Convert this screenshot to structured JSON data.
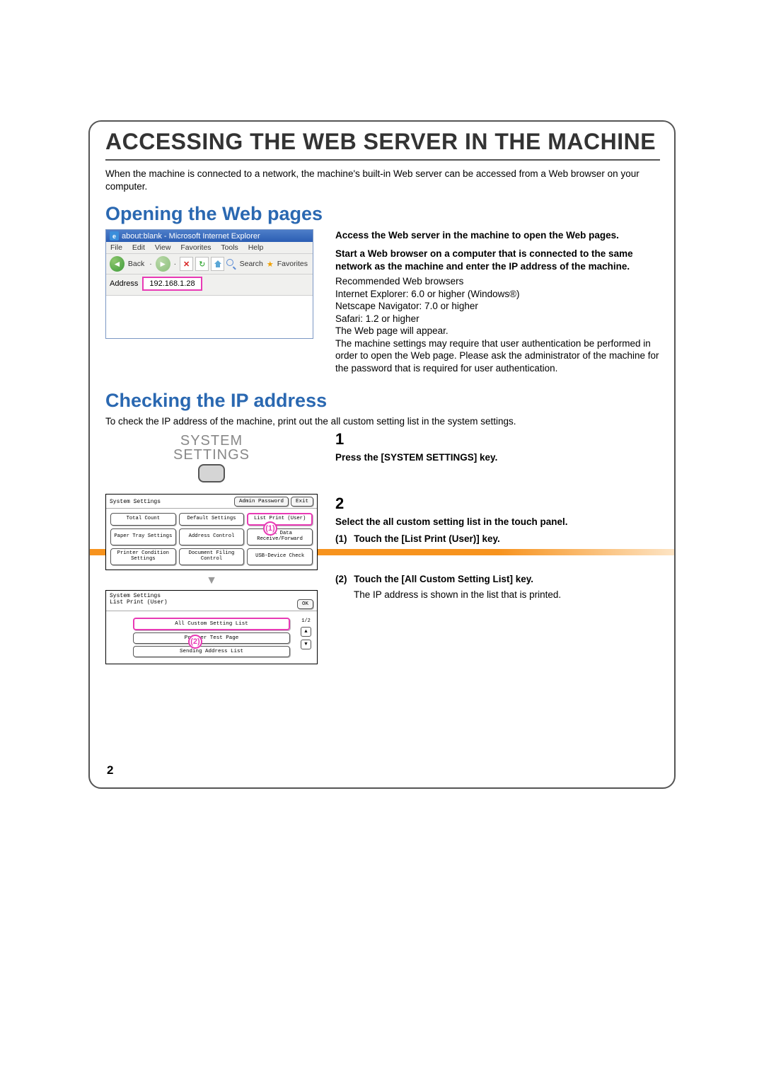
{
  "title": "ACCESSING THE WEB SERVER IN THE MACHINE",
  "intro": "When the machine is connected to a network, the machine's built-in Web server can be accessed from a Web browser on your computer.",
  "section1": {
    "heading": "Opening the Web pages",
    "ie": {
      "title": "about:blank - Microsoft Internet Explorer",
      "menu": [
        "File",
        "Edit",
        "View",
        "Favorites",
        "Tools",
        "Help"
      ],
      "back": "Back",
      "search": "Search",
      "favorites": "Favorites",
      "address_label": "Address",
      "address_value": "192.168.1.28"
    },
    "right": {
      "lead": "Access the Web server in the machine to open the Web pages.",
      "step": "Start a Web browser on a computer that is connected to the same network as the machine and enter the IP address of the machine.",
      "lines": [
        "Recommended Web browsers",
        "Internet Explorer: 6.0 or higher (Windows®)",
        "Netscape Navigator: 7.0 or higher",
        "Safari: 1.2 or higher",
        "The Web page will appear.",
        "The machine settings may require that user authentication be performed in order to open the Web page. Please ask the administrator of the machine for the password that is required for user authentication."
      ]
    }
  },
  "section2": {
    "heading": "Checking the IP address",
    "intro": "To check the IP address of the machine, print out the all custom setting list in the system settings.",
    "syskey": {
      "line1": "SYSTEM",
      "line2": "SETTINGS"
    },
    "step1": {
      "num": "1",
      "text": "Press the [SYSTEM SETTINGS] key."
    },
    "step2": {
      "num": "2",
      "head": "Select the all custom setting list in the touch panel.",
      "sub1_n": "(1)",
      "sub1_t": "Touch the [List Print (User)] key.",
      "sub2_n": "(2)",
      "sub2_t": "Touch the [All Custom Setting List] key.",
      "note": "The IP address is shown in the list that is printed."
    },
    "panel1": {
      "title": "System Settings",
      "admin": "Admin Password",
      "exit": "Exit",
      "buttons": [
        "Total Count",
        "Default Settings",
        "List Print (User)",
        "Paper Tray Settings",
        "Address Control",
        "Fax Data Receive/Forward",
        "Printer Condition Settings",
        "Document Filing Control",
        "USB-Device Check"
      ],
      "callout": "(1)"
    },
    "panel2": {
      "title": "System Settings",
      "sub": "List Print (User)",
      "ok": "OK",
      "items": [
        "All Custom Setting List",
        "Printer Test Page",
        "Sending Address List"
      ],
      "page": "1/2",
      "callout": "(2)"
    }
  },
  "page_number": "2"
}
